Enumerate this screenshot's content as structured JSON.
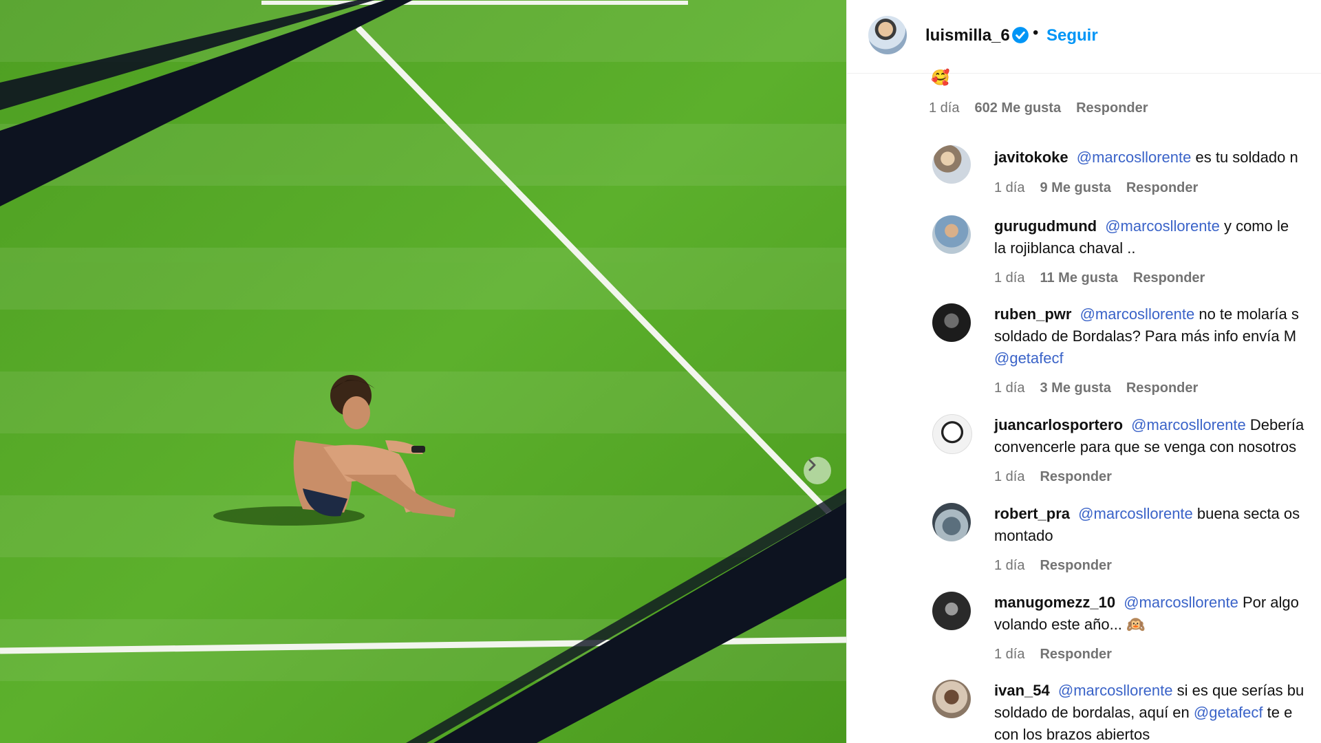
{
  "post": {
    "author": "luismilla_6",
    "follow_label": "Seguir",
    "separator": "•"
  },
  "top_meta": {
    "emoji": "🥰",
    "time": "1 día",
    "likes": "602 Me gusta",
    "reply": "Responder"
  },
  "comments": [
    {
      "user": "javitokoke",
      "mention": "@marcosllorente",
      "text": "es tu soldado n",
      "time": "1 día",
      "likes": "9 Me gusta",
      "reply": "Responder"
    },
    {
      "user": "gurugudmund",
      "mention": "@marcosllorente",
      "text": "y como le",
      "text2": "la rojiblanca chaval ..",
      "time": "1 día",
      "likes": "11 Me gusta",
      "reply": "Responder"
    },
    {
      "user": "ruben_pwr",
      "mention": "@marcosllorente",
      "text": "no te molaría s",
      "text2": "soldado de Bordalas? Para más info envía M",
      "mention2": "@getafecf",
      "time": "1 día",
      "likes": "3 Me gusta",
      "reply": "Responder"
    },
    {
      "user": "juancarlosportero",
      "mention": "@marcosllorente",
      "text": "Debería",
      "text2": "convencerle para que se venga con nosotros",
      "time": "1 día",
      "reply": "Responder"
    },
    {
      "user": "robert_pra",
      "mention": "@marcosllorente",
      "text": "buena secta os",
      "text2": "montado",
      "time": "1 día",
      "reply": "Responder"
    },
    {
      "user": "manugomezz_10",
      "mention": "@marcosllorente",
      "text": "Por algo",
      "text2": "volando este año... 🙉",
      "time": "1 día",
      "reply": "Responder"
    },
    {
      "user": "ivan_54",
      "mention": "@marcosllorente",
      "text": "si es que serías bu",
      "text2a": "soldado de bordalas, aquí en",
      "mention2": "@getafecf",
      "text2b": "te e",
      "text3": "con los brazos abiertos"
    }
  ],
  "icons": [
    "verified-badge-icon",
    "chevron-right-icon"
  ],
  "colors": {
    "link": "#0095f6",
    "mention": "#3a63c8",
    "muted": "#737373",
    "pitch": "#54a626"
  }
}
